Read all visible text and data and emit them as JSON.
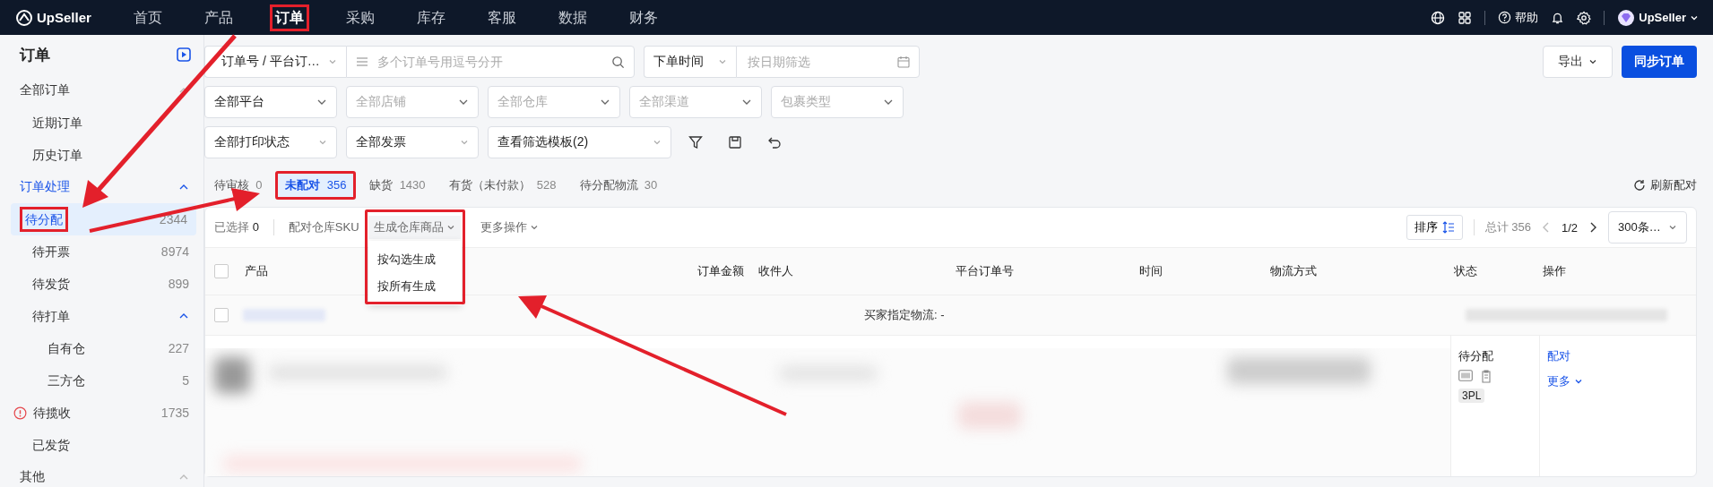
{
  "topbar": {
    "logo": "UpSeller",
    "nav": [
      {
        "label": "首页",
        "selected": false,
        "highlighted": false
      },
      {
        "label": "产品",
        "selected": false,
        "highlighted": false
      },
      {
        "label": "订单",
        "selected": true,
        "highlighted": true
      },
      {
        "label": "采购",
        "selected": false,
        "highlighted": false
      },
      {
        "label": "库存",
        "selected": false,
        "highlighted": false
      },
      {
        "label": "客服",
        "selected": false,
        "highlighted": false
      },
      {
        "label": "数据",
        "selected": false,
        "highlighted": false
      },
      {
        "label": "财务",
        "selected": false,
        "highlighted": false
      }
    ],
    "help": "帮助",
    "user": "UpSeller"
  },
  "sidebar": {
    "title": "订单",
    "groups": [
      {
        "label": "全部订单",
        "active": false,
        "expanded": true,
        "children": [
          {
            "label": "近期订单",
            "selected": false,
            "highlighted": false,
            "alert": false
          },
          {
            "label": "历史订单",
            "selected": false,
            "highlighted": false,
            "alert": false
          }
        ]
      },
      {
        "label": "订单处理",
        "active": true,
        "expanded": true,
        "children": [
          {
            "label": "待分配",
            "count": "2344",
            "selected": true,
            "highlighted": true,
            "alert": false
          },
          {
            "label": "待开票",
            "count": "8974",
            "selected": false,
            "highlighted": false,
            "alert": false
          },
          {
            "label": "待发货",
            "count": "899",
            "selected": false,
            "highlighted": false,
            "alert": false
          },
          {
            "label": "待打单",
            "selected": false,
            "highlighted": false,
            "alert": false,
            "expanded": true,
            "children": [
              {
                "label": "自有仓",
                "count": "227",
                "selected": false
              },
              {
                "label": "三方仓",
                "count": "5",
                "selected": false
              }
            ]
          },
          {
            "label": "待揽收",
            "count": "1735",
            "selected": false,
            "highlighted": false,
            "alert": true
          },
          {
            "label": "已发货",
            "selected": false,
            "highlighted": false,
            "alert": false
          }
        ]
      },
      {
        "label": "其他",
        "active": false,
        "expanded": true
      }
    ]
  },
  "filters": {
    "search_type": "订单号 / 平台订…",
    "search": {
      "placeholder": "多个订单号用逗号分开"
    },
    "time_type": "下单时间",
    "date": {
      "placeholder": "按日期筛选"
    },
    "row2": [
      {
        "text": "全部平台",
        "placeholder": false
      },
      {
        "text": "全部店铺",
        "placeholder": true
      },
      {
        "text": "全部仓库",
        "placeholder": true
      },
      {
        "text": "全部渠道",
        "placeholder": true
      },
      {
        "text": "包裹类型",
        "placeholder": true
      }
    ],
    "row3": [
      "全部打印状态",
      "全部发票",
      "查看筛选模板(2)"
    ]
  },
  "actions": {
    "export": "导出",
    "sync": "同步订单"
  },
  "status_tabs": [
    {
      "label": "待审核",
      "count": "0",
      "selected": false,
      "highlighted": false
    },
    {
      "label": "未配对",
      "count": "356",
      "selected": true,
      "highlighted": true
    },
    {
      "label": "缺货",
      "count": "1430",
      "selected": false,
      "highlighted": false
    },
    {
      "label": "有货（未付款）",
      "count": "528",
      "selected": false,
      "highlighted": false
    },
    {
      "label": "待分配物流",
      "count": "30",
      "selected": false,
      "highlighted": false
    }
  ],
  "refresh": "刷新配对",
  "toolbar": {
    "selected_label": "已选择",
    "selected_count": "0",
    "match_sku": "配对仓库SKU",
    "generate": {
      "label": "生成仓库商品",
      "expanded": true,
      "highlighted": true,
      "options": [
        "按勾选生成",
        "按所有生成"
      ]
    },
    "more": "更多操作",
    "sort": "排序",
    "total": "总计 356",
    "page": "1/2",
    "page_size": "300条…"
  },
  "table": {
    "header_checked": false,
    "columns": [
      "产品",
      "订单金额",
      "收件人",
      "平台订单号",
      "时间",
      "物流方式",
      "状态",
      "操作"
    ],
    "group_row": {
      "checked": false,
      "logistics": "买家指定物流: -"
    },
    "rows": [
      {
        "status": "待分配",
        "tag": "3PL",
        "actions": [
          "配对",
          "更多"
        ]
      }
    ]
  }
}
